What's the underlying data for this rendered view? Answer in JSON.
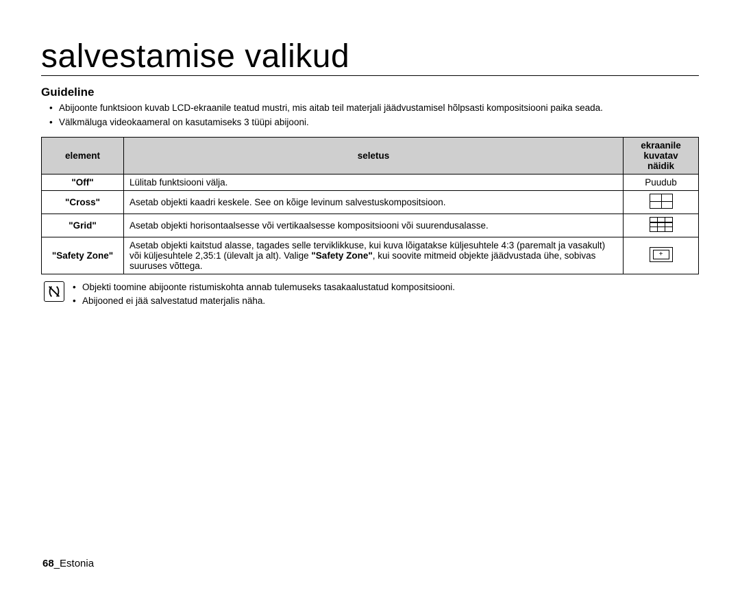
{
  "page_title": "salvestamise valikud",
  "section_heading": "Guideline",
  "intro_bullets": [
    "Abijoonte funktsioon kuvab LCD-ekraanile teatud mustri, mis aitab teil materjali jäädvustamisel hõlpsasti kompositsiooni paika seada.",
    "Välkmäluga videokaameral on kasutamiseks 3 tüüpi abijooni."
  ],
  "table": {
    "headers": {
      "element": "element",
      "seletus": "seletus",
      "display": "ekraanile kuvatav näidik"
    },
    "rows": [
      {
        "key": "\"Off\"",
        "desc": "Lülitab funktsiooni välja.",
        "display_text": "Puudub",
        "icon": null
      },
      {
        "key": "\"Cross\"",
        "desc": "Asetab objekti kaadri keskele. See on kõige levinum salvestuskompositsioon.",
        "icon": "cross"
      },
      {
        "key": "\"Grid\"",
        "desc": "Asetab objekti horisontaalsesse või vertikaalsesse kompositsiooni või suurendusalasse.",
        "icon": "grid"
      },
      {
        "key": "\"Safety Zone\"",
        "desc_pre": "Asetab objekti kaitstud alasse, tagades selle terviklikkuse, kui kuva lõigatakse küljesuhtele 4:3 (paremalt ja vasakult) või küljesuhtele 2,35:1 (ülevalt ja alt). Valige ",
        "desc_bold": "\"Safety Zone\"",
        "desc_post": ", kui soovite mitmeid objekte jäädvustada ühe, sobivas suuruses võttega.",
        "icon": "safety"
      }
    ]
  },
  "note_bullets": [
    "Objekti toomine abijoonte ristumiskohta annab tulemuseks tasakaalustatud kompositsiooni.",
    "Abijooned ei jää salvestatud materjalis näha."
  ],
  "footer": {
    "page": "68",
    "label": "_Estonia"
  }
}
